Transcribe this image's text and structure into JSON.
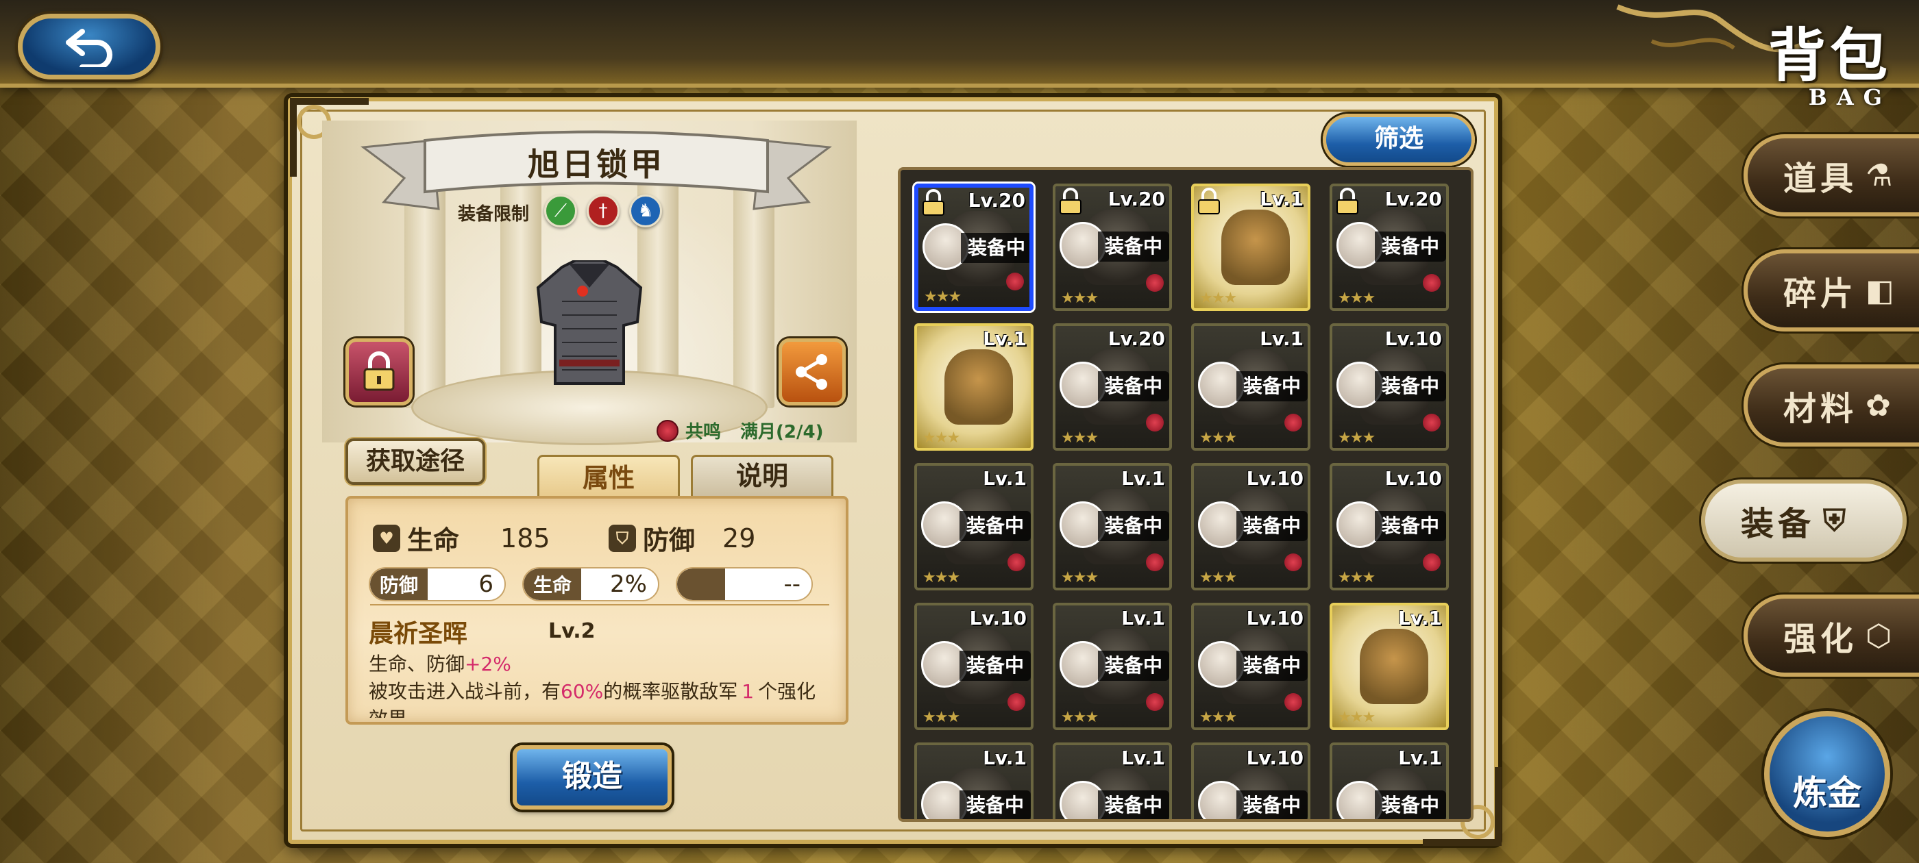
{
  "header": {
    "title": "背包",
    "subtitle": "BAG",
    "back_icon": "back-arrow-icon"
  },
  "detail": {
    "item_name": "旭日锁甲",
    "restriction_label": "装备限制",
    "restriction_icons": [
      "spear-icon",
      "sword-icon",
      "horse-icon"
    ],
    "resonance_label": "共鸣",
    "resonance_value": "满月(2/4)",
    "obtain_label": "获取途径",
    "tabs": {
      "attributes": "属性",
      "description": "说明"
    },
    "stats": {
      "hp_label": "生命",
      "hp_value": "185",
      "def_label": "防御",
      "def_value": "29"
    },
    "substats": [
      {
        "label": "防御",
        "value": "6"
      },
      {
        "label": "生命",
        "value": "2%"
      },
      {
        "label": "",
        "value": "--"
      }
    ],
    "skill": {
      "name": "晨祈圣晖",
      "level": "Lv.2",
      "effect_prefix": "生命、防御",
      "effect_bonus": "+2%",
      "desc_a": "被攻击进入战斗前，有",
      "desc_pct": "60%",
      "desc_b": "的概率驱散敌军",
      "desc_num": "1",
      "desc_c": "个强化效果"
    },
    "forge_label": "锻造"
  },
  "filter_label": "筛选",
  "equipped_tag": "装备中",
  "grid": [
    {
      "lv": "Lv.20",
      "locked": true,
      "equipped": true,
      "selected": true
    },
    {
      "lv": "Lv.20",
      "locked": true,
      "equipped": true
    },
    {
      "lv": "Lv.1",
      "locked": true,
      "equipped": false,
      "gold": true
    },
    {
      "lv": "Lv.20",
      "locked": true,
      "equipped": true
    },
    {
      "lv": "Lv.1",
      "equipped": false,
      "gold": true
    },
    {
      "lv": "Lv.20",
      "equipped": true
    },
    {
      "lv": "Lv.1",
      "equipped": true
    },
    {
      "lv": "Lv.10",
      "equipped": true
    },
    {
      "lv": "Lv.1",
      "equipped": true
    },
    {
      "lv": "Lv.1",
      "equipped": true
    },
    {
      "lv": "Lv.10",
      "equipped": true
    },
    {
      "lv": "Lv.10",
      "equipped": true
    },
    {
      "lv": "Lv.10",
      "equipped": true
    },
    {
      "lv": "Lv.1",
      "equipped": true
    },
    {
      "lv": "Lv.10",
      "equipped": true
    },
    {
      "lv": "Lv.1",
      "equipped": false,
      "gold": true
    },
    {
      "lv": "Lv.1",
      "equipped": true
    },
    {
      "lv": "Lv.1",
      "equipped": true
    },
    {
      "lv": "Lv.10",
      "equipped": true
    },
    {
      "lv": "Lv.1",
      "equipped": true
    }
  ],
  "nav": [
    {
      "label": "道具",
      "icon": "flask-icon",
      "active": false
    },
    {
      "label": "碎片",
      "icon": "shard-icon",
      "active": false
    },
    {
      "label": "材料",
      "icon": "gear-icon",
      "active": false
    },
    {
      "label": "装备",
      "icon": "armor-icon",
      "active": true
    },
    {
      "label": "强化",
      "icon": "upgrade-icon",
      "active": false
    }
  ],
  "alchemy_label": "炼金"
}
